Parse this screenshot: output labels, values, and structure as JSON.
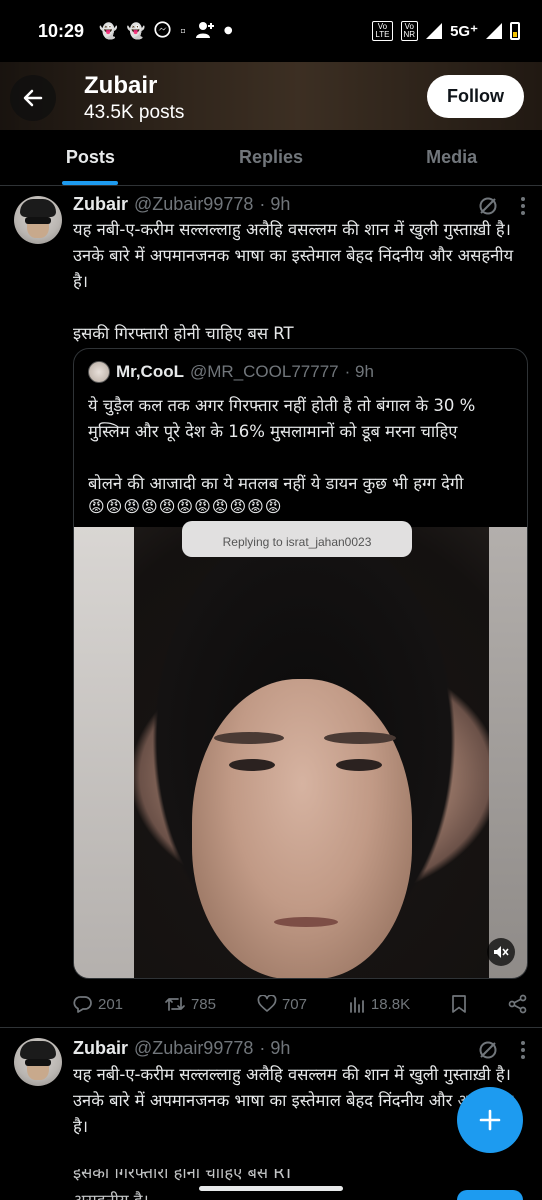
{
  "status_bar": {
    "time": "10:29",
    "network": "5G⁺",
    "sim1": "Vo LTE",
    "sim2": "Vo NR"
  },
  "header": {
    "name": "Zubair",
    "posts_count": "43.5K posts",
    "follow_label": "Follow"
  },
  "tabs": [
    {
      "label": "Posts",
      "active": true
    },
    {
      "label": "Replies",
      "active": false
    },
    {
      "label": "Media",
      "active": false
    }
  ],
  "tweets": [
    {
      "name": "Zubair",
      "handle": "@Zubair99778",
      "time": "· 9h",
      "text": "यह नबी-ए-करीम सल्लल्लाहु अलैहि वसल्लम की शान में खुली गुस्ताख़ी है। उनके बारे में अपमानजनक भाषा का इस्तेमाल बेहद निंदनीय और असहनीय है।\n\nइसकी गिरफ्तारी होनी चाहिए बस RT",
      "quote": {
        "name": "Mr,CooL",
        "handle": "@MR_COOL77777",
        "time": "· 9h",
        "text": "ये चुड़ैल कल तक अगर गिरफ्तार नहीं होती है तो बंगाल के 30 % मुस्लिम और पूरे देश के 16% मुसलामानों को डूब मरना चाहिए\n\nबोलने की आजादी का ये मतलब नहीं ये डायन कुछ भी हग्ग देगी",
        "emoji": "😡😡😡😡😡😡😡😡😡😡😡",
        "media_overlay": "Replying to israt_jahan0023"
      },
      "stats": {
        "replies": "201",
        "reposts": "785",
        "likes": "707",
        "views": "18.8K"
      }
    },
    {
      "name": "Zubair",
      "handle": "@Zubair99778",
      "time": "· 9h",
      "text": "यह नबी-ए-करीम सल्लल्लाहु अलैहि वसल्लम की शान में खुली गुस्ताख़ी है। उनके बारे में अपमानजनक भाषा का इस्तेमाल बेहद निंदनीय और असहनीय है।",
      "partial_line": "इसकी गिरफ्तारी होनी चाहिए बस RT",
      "partial_line2": "असहनीय है।"
    }
  ],
  "colors": {
    "accent": "#1d9bf0",
    "secondary_text": "#71767b",
    "primary_text": "#e7e9ea",
    "border": "#2f3336"
  }
}
